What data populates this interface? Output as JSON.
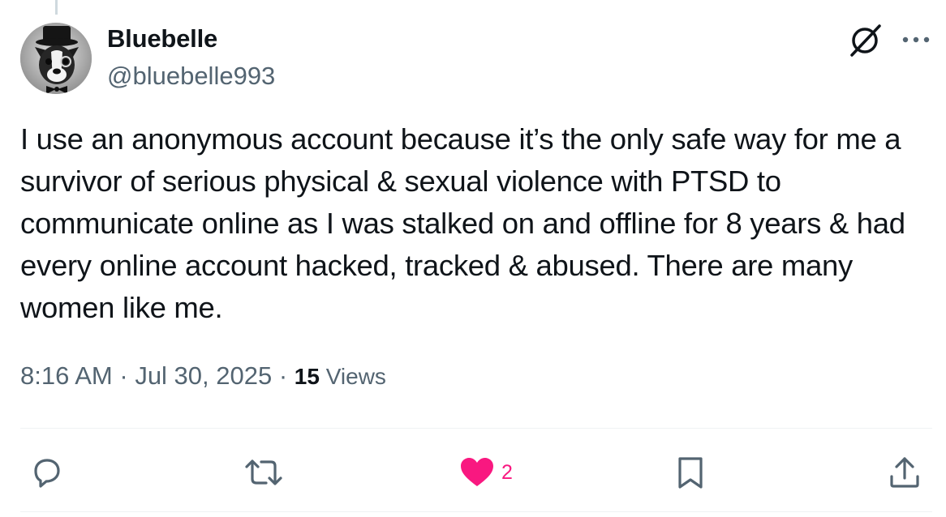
{
  "tweet": {
    "author": {
      "name": "Bluebelle",
      "handle": "@bluebelle993"
    },
    "text": "I use an anonymous account because it’s the only safe way for me a survivor of serious physical & sexual violence with PTSD to communicate online as I was stalked on and offline for 8 years & had every online account hacked, tracked & abused. There are many women like me.",
    "time": "8:16 AM",
    "separator": " · ",
    "date": "Jul 30, 2025",
    "views_count": "15",
    "views_label": " Views"
  },
  "actions": {
    "reply": {
      "icon": "reply-icon"
    },
    "repost": {
      "icon": "repost-icon"
    },
    "like": {
      "icon": "heart-filled-icon",
      "count": "2",
      "color": "#f91880"
    },
    "bookmark": {
      "icon": "bookmark-icon"
    },
    "share": {
      "icon": "share-icon"
    }
  },
  "header_icons": {
    "grok": "grok-icon",
    "more": "more-dots-icon"
  },
  "colors": {
    "text": "#0f1419",
    "secondary": "#536471",
    "like": "#f91880",
    "divider": "#eff3f4"
  }
}
